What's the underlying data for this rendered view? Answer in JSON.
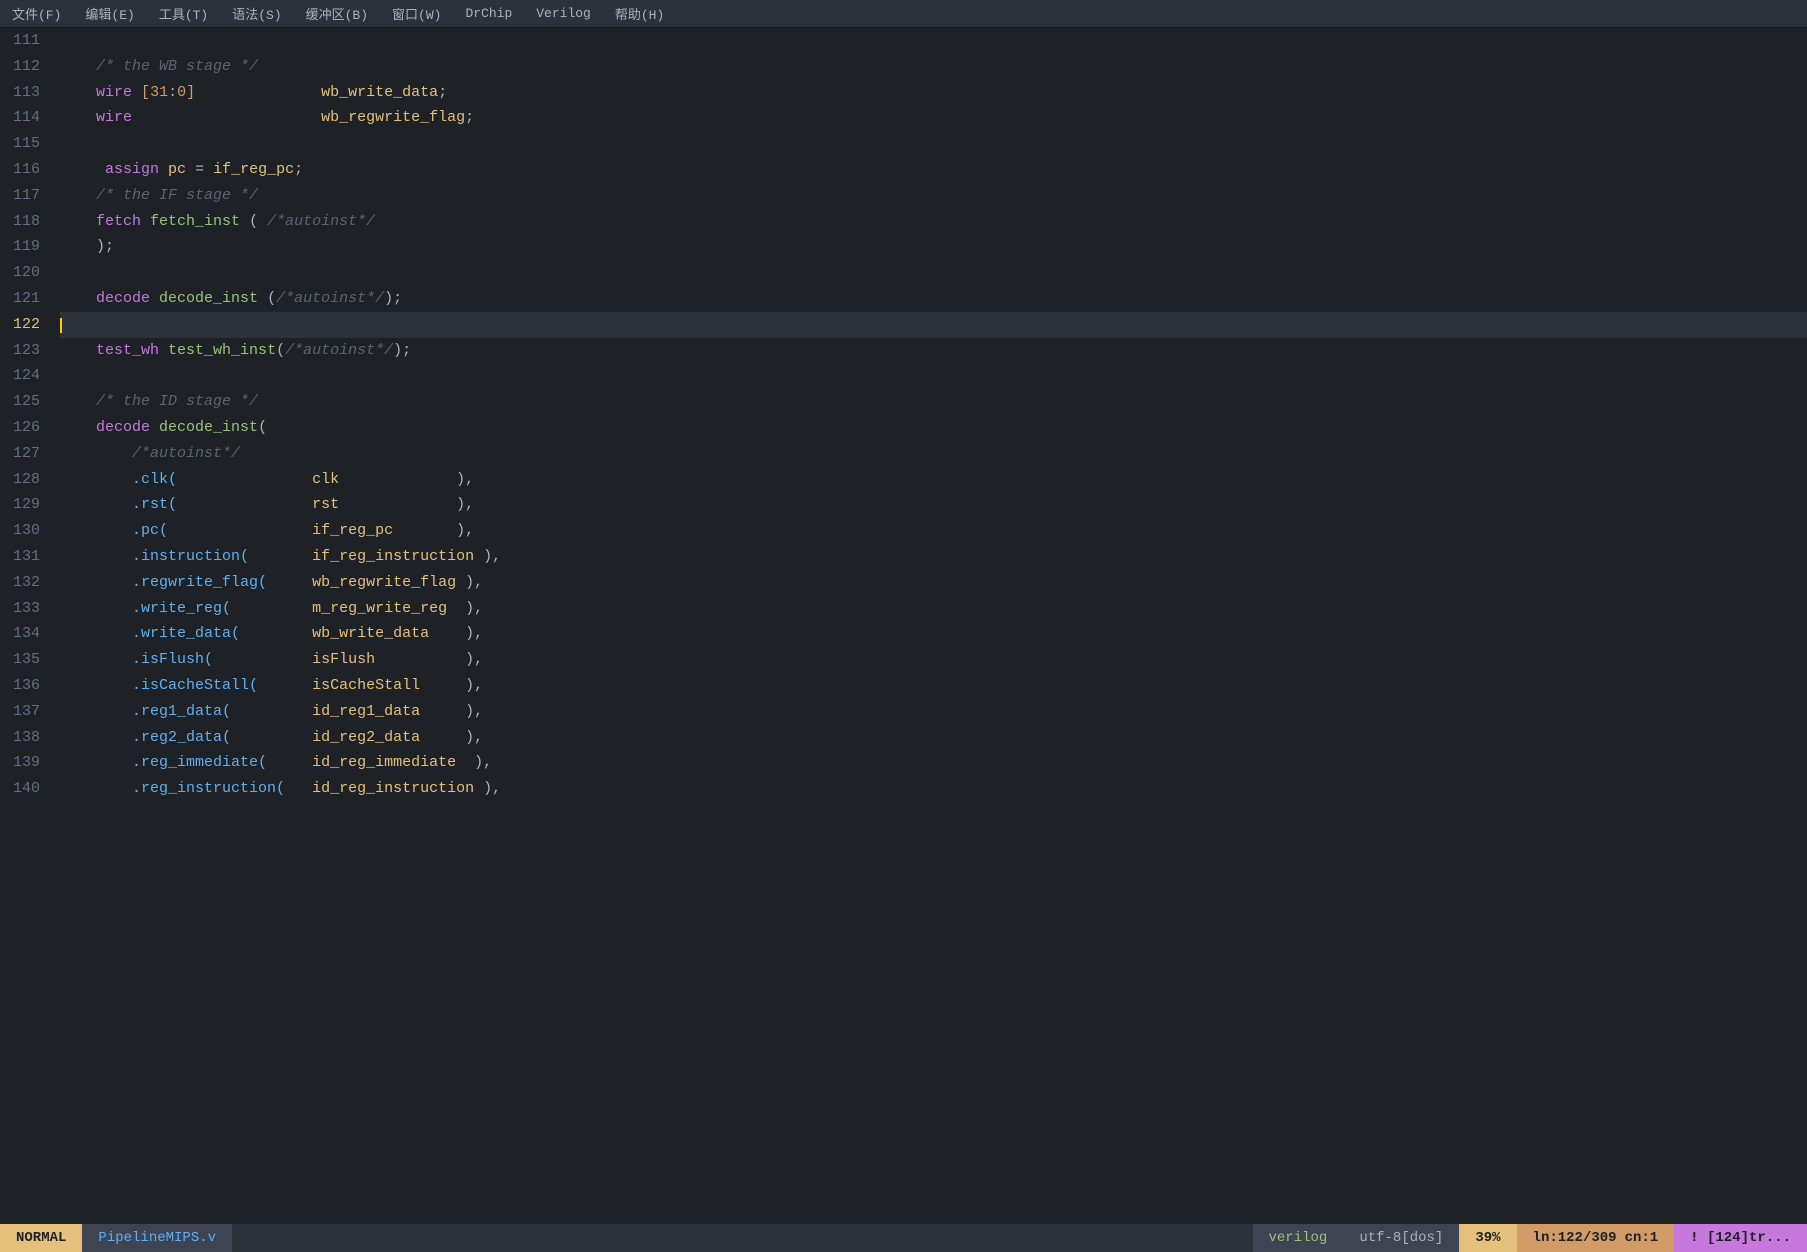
{
  "menubar": {
    "items": [
      "文件(F)",
      "编辑(E)",
      "工具(T)",
      "语法(S)",
      "缓冲区(B)",
      "窗口(W)",
      "DrChip",
      "Verilog",
      "帮助(H)"
    ]
  },
  "lines": [
    {
      "num": "111",
      "content": "",
      "type": "empty"
    },
    {
      "num": "112",
      "content": "    /* the WB stage */",
      "type": "comment"
    },
    {
      "num": "113",
      "content": "    wire [31:0]              wb_write_data;",
      "type": "code"
    },
    {
      "num": "114",
      "content": "    wire                     wb_regwrite_flag;",
      "type": "code"
    },
    {
      "num": "115",
      "content": "",
      "type": "empty"
    },
    {
      "num": "116",
      "content": "     assign pc = if_reg_pc;",
      "type": "code"
    },
    {
      "num": "117",
      "content": "    /* the IF stage */",
      "type": "comment"
    },
    {
      "num": "118",
      "content": "    fetch fetch_inst ( /*autoinst*/",
      "type": "code"
    },
    {
      "num": "119",
      "content": "    );",
      "type": "code"
    },
    {
      "num": "120",
      "content": "",
      "type": "empty"
    },
    {
      "num": "121",
      "content": "    decode decode_inst (/*autoinst*/);",
      "type": "code"
    },
    {
      "num": "122",
      "content": "",
      "type": "cursor"
    },
    {
      "num": "123",
      "content": "    test_wh test_wh_inst(/*autoinst*/);",
      "type": "code"
    },
    {
      "num": "124",
      "content": "",
      "type": "empty"
    },
    {
      "num": "125",
      "content": "    /* the ID stage */",
      "type": "comment"
    },
    {
      "num": "126",
      "content": "    decode decode_inst(",
      "type": "code"
    },
    {
      "num": "127",
      "content": "        /*autoinst*/",
      "type": "comment"
    },
    {
      "num": "128",
      "content": "        .clk(               clk             ),",
      "type": "port"
    },
    {
      "num": "129",
      "content": "        .rst(               rst             ),",
      "type": "port"
    },
    {
      "num": "130",
      "content": "        .pc(                if_reg_pc       ),",
      "type": "port"
    },
    {
      "num": "131",
      "content": "        .instruction(       if_reg_instruction ),",
      "type": "port"
    },
    {
      "num": "132",
      "content": "        .regwrite_flag(     wb_regwrite_flag ),",
      "type": "port"
    },
    {
      "num": "133",
      "content": "        .write_reg(         m_reg_write_reg  ),",
      "type": "port"
    },
    {
      "num": "134",
      "content": "        .write_data(        wb_write_data    ),",
      "type": "port"
    },
    {
      "num": "135",
      "content": "        .isFlush(           isFlush          ),",
      "type": "port"
    },
    {
      "num": "136",
      "content": "        .isCacheStall(      isCacheStall     ),",
      "type": "port"
    },
    {
      "num": "137",
      "content": "        .reg1_data(         id_reg1_data     ),",
      "type": "port"
    },
    {
      "num": "138",
      "content": "        .reg2_data(         id_reg2_data     ),",
      "type": "port"
    },
    {
      "num": "139",
      "content": "        .reg_immediate(     id_reg_immediate  ),",
      "type": "port"
    },
    {
      "num": "140",
      "content": "        .reg_instruction(   id_reg_instruction ),",
      "type": "port"
    }
  ],
  "statusbar": {
    "mode": "NORMAL",
    "file": "PipelineMIPS.v",
    "filetype": "verilog",
    "encoding": "utf-8[dos]",
    "percent": "39%",
    "position": "ln:122/309",
    "cn": "cn:1",
    "extra": "! [124]tr..."
  }
}
